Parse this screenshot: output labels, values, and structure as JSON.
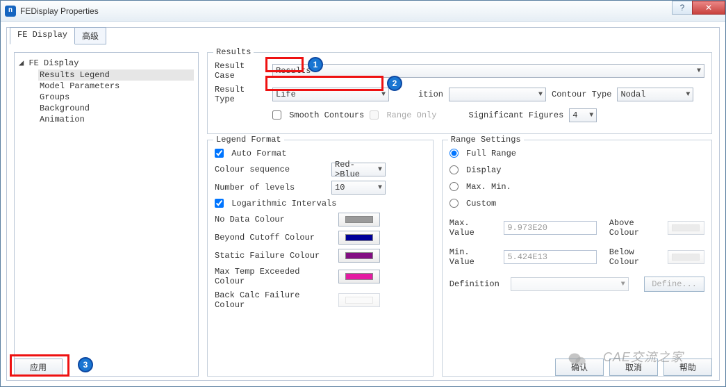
{
  "window": {
    "title": "FEDisplay Properties"
  },
  "tabs": {
    "active": "FE Display",
    "inactive": "高级"
  },
  "tree": {
    "root": "FE Display",
    "items": [
      "Results Legend",
      "Model Parameters",
      "Groups",
      "Background",
      "Animation"
    ],
    "selected": 0
  },
  "results": {
    "legend": "Results",
    "result_case_label": "Result Case",
    "result_case_value": "Results",
    "result_type_label": "Result Type",
    "result_type_value": "Life",
    "result_definition_label": "ition",
    "result_definition_value": "",
    "contour_type_label": "Contour Type",
    "contour_type_value": "Nodal",
    "smooth_contours_label": "Smooth Contours",
    "smooth_contours_checked": false,
    "range_only_label": "Range Only",
    "range_only_checked": false,
    "sigfig_label": "Significant Figures",
    "sigfig_value": "4"
  },
  "legend_format": {
    "legend": "Legend Format",
    "auto_format_label": "Auto Format",
    "auto_format_checked": true,
    "colour_seq_label": "Colour sequence",
    "colour_seq_value": "Red->Blue",
    "levels_label": "Number of levels",
    "levels_value": "10",
    "log_int_label": "Logarithmic Intervals",
    "log_int_checked": true,
    "rows": [
      {
        "label": "No Data Colour",
        "color": "#9a9a9a"
      },
      {
        "label": "Beyond Cutoff Colour",
        "color": "#000099"
      },
      {
        "label": "Static Failure Colour",
        "color": "#820d82"
      },
      {
        "label": "Max Temp Exceeded Colour",
        "color": "#e41ba2"
      },
      {
        "label": "Back Calc Failure Colour",
        "color": ""
      }
    ]
  },
  "range_settings": {
    "legend": "Range Settings",
    "options": [
      "Full Range",
      "Display",
      "Max. Min.",
      "Custom"
    ],
    "selected": 0,
    "max_label": "Max. Value",
    "max_value": "9.973E20",
    "min_label": "Min. Value",
    "min_value": "5.424E13",
    "above_label": "Above Colour",
    "above_color": "#d8d8d8",
    "below_label": "Below Colour",
    "below_color": "#d8d8d8",
    "definition_label": "Definition",
    "definition_value": "",
    "define_btn": "Define..."
  },
  "footer": {
    "apply": "应用",
    "ok": "确认",
    "cancel": "取消",
    "help": "帮助"
  },
  "annotations": {
    "b1": "1",
    "b2": "2",
    "b3": "3"
  },
  "watermark": "CAE交流之家"
}
